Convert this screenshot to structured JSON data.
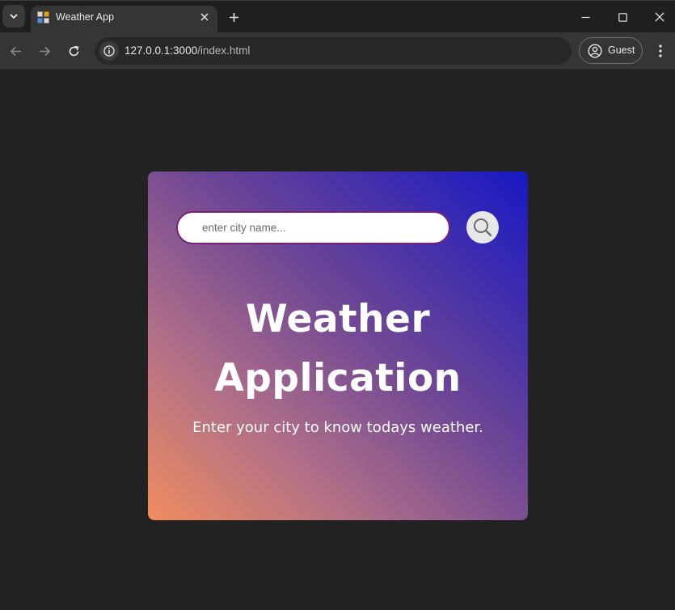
{
  "browser": {
    "tab_title": "Weather App",
    "url_host": "127.0.0.1:3000",
    "url_path": "/index.html",
    "profile_label": "Guest",
    "icons": {
      "tab_search": "chevron-down-icon",
      "tab_favicon": "weather-favicon",
      "tab_close": "close-icon",
      "new_tab": "plus-icon",
      "minimize": "minimize-icon",
      "maximize": "maximize-icon",
      "close_window": "close-icon",
      "back": "arrow-left-icon",
      "forward": "arrow-right-icon",
      "reload": "reload-icon",
      "site_info": "info-icon",
      "profile": "account-circle-icon",
      "menu": "more-vertical-icon"
    }
  },
  "app": {
    "search": {
      "placeholder": "enter city name...",
      "value": "",
      "button_icon": "search-icon"
    },
    "headline_line1": "Weather",
    "headline_line2": "Application",
    "subtitle": "Enter your city to know todays weather.",
    "colors": {
      "gradient_start": "#f08d5f",
      "gradient_mid": "#6a4496",
      "gradient_end": "#1718c4",
      "input_border": "#7a1f7a",
      "page_background": "#222222"
    }
  }
}
